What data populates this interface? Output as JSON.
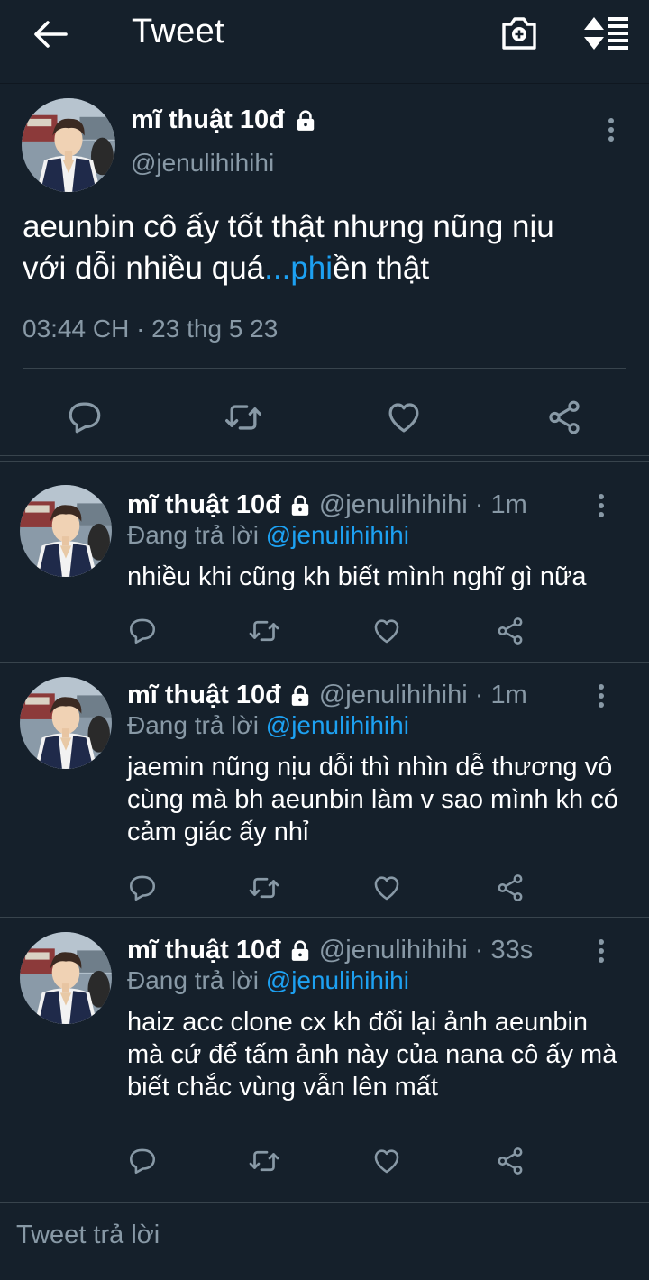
{
  "header": {
    "title": "Tweet"
  },
  "main_tweet": {
    "name": "mĩ thuật 10đ",
    "handle": "@jenulihihihi",
    "text_line1": "aeunbin cô ấy tốt thật nhưng nũng nịu",
    "text_line2_pre": "với dỗi nhiều quá",
    "text_link": "...phi",
    "text_line2_post": "ền thật",
    "timestamp": "03:44 CH · 23 thg 5 23"
  },
  "replies": [
    {
      "name": "mĩ thuật 10đ",
      "handle": "@jenulihihihi · 1m",
      "replying_prefix": "Đang trả lời ",
      "replying_to": "@jenulihihihi",
      "text": "nhiều khi cũng kh biết mình nghĩ gì nữa"
    },
    {
      "name": "mĩ thuật 10đ",
      "handle": "@jenulihihihi · 1m",
      "replying_prefix": "Đang trả lời ",
      "replying_to": "@jenulihihihi",
      "text": "jaemin nũng nịu dỗi thì nhìn dễ thương vô cùng mà bh aeunbin làm v sao mình kh có cảm giác ấy nhỉ"
    },
    {
      "name": "mĩ thuật 10đ",
      "handle": "@jenulihihihi · 33s",
      "replying_prefix": "Đang trả lời ",
      "replying_to": "@jenulihihihi",
      "text": "haiz acc clone cx kh đổi lại ảnh aeunbin mà cứ để tấm ảnh này của nana cô ấy mà biết chắc vùng vẫn lên mất"
    }
  ],
  "composer": {
    "placeholder": "Tweet trả lời"
  },
  "colors": {
    "background": "#15202b",
    "secondary_text": "#8899a6",
    "link": "#1da1f2",
    "divider": "#38444d"
  },
  "icons": [
    "back-arrow-icon",
    "camera-plus-icon",
    "sort-list-icon",
    "lock-icon",
    "more-vertical-icon",
    "reply-icon",
    "retweet-icon",
    "like-icon",
    "share-icon"
  ]
}
